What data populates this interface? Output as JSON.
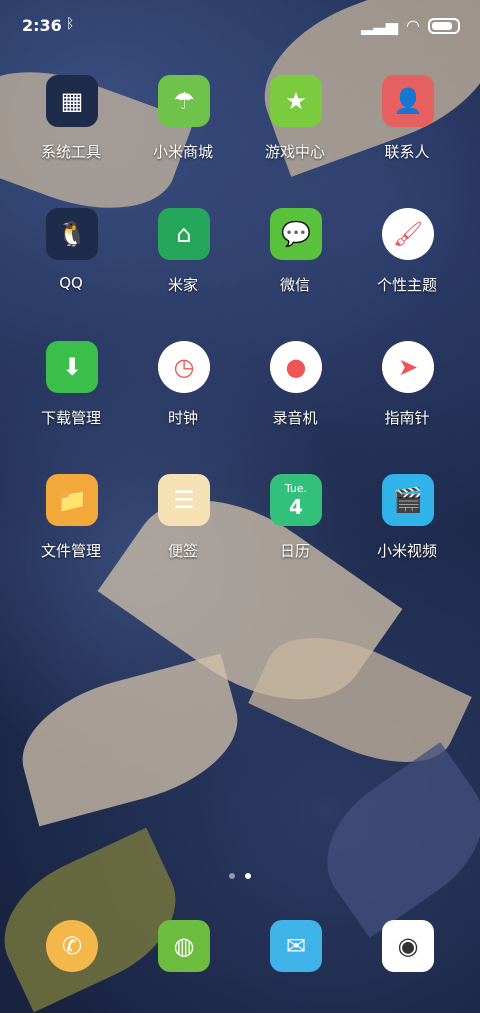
{
  "status_bar": {
    "time": "2:36",
    "bluetooth_icon": "bluetooth-icon",
    "signal_icon": "signal-icon",
    "wifi_icon": "wifi-icon",
    "battery_level": 0.85
  },
  "apps": [
    {
      "label": "系统工具",
      "icon": "folder-icon",
      "bg": "#1f2b4a"
    },
    {
      "label": "小米商城",
      "icon": "umbrella-icon",
      "bg": "#6fc24a"
    },
    {
      "label": "游戏中心",
      "icon": "star-icon",
      "bg": "#7acb3d"
    },
    {
      "label": "联系人",
      "icon": "person-icon",
      "bg": "#e6605f"
    },
    {
      "label": "QQ",
      "icon": "qq-icon",
      "bg": "#1f2b4a"
    },
    {
      "label": "米家",
      "icon": "mijia-icon",
      "bg": "#26a65b"
    },
    {
      "label": "微信",
      "icon": "wechat-icon",
      "bg": "#59c13b"
    },
    {
      "label": "个性主题",
      "icon": "brush-icon",
      "bg": "#ffffff"
    },
    {
      "label": "下载管理",
      "icon": "download-icon",
      "bg": "#3abf4b"
    },
    {
      "label": "时钟",
      "icon": "clock-icon",
      "bg": "#ffffff"
    },
    {
      "label": "录音机",
      "icon": "record-icon",
      "bg": "#ffffff"
    },
    {
      "label": "指南针",
      "icon": "compass-icon",
      "bg": "#ffffff"
    },
    {
      "label": "文件管理",
      "icon": "file-icon",
      "bg": "#f3a83b"
    },
    {
      "label": "便签",
      "icon": "notes-icon",
      "bg": "#f6e1b5"
    },
    {
      "label": "日历",
      "icon": "calendar-icon",
      "bg": "#32c07a",
      "calendar_day": "Tue.",
      "calendar_date": "4"
    },
    {
      "label": "小米视频",
      "icon": "video-icon",
      "bg": "#2fb3e8"
    }
  ],
  "dock": [
    {
      "icon": "phone-icon",
      "bg": "#f4b74a"
    },
    {
      "icon": "browser-icon",
      "bg": "#6cbc3f"
    },
    {
      "icon": "message-icon",
      "bg": "#3fb2e8"
    },
    {
      "icon": "camera-icon",
      "bg": "#ffffff"
    }
  ],
  "page_indicator": {
    "pages": 2,
    "current": 2
  }
}
